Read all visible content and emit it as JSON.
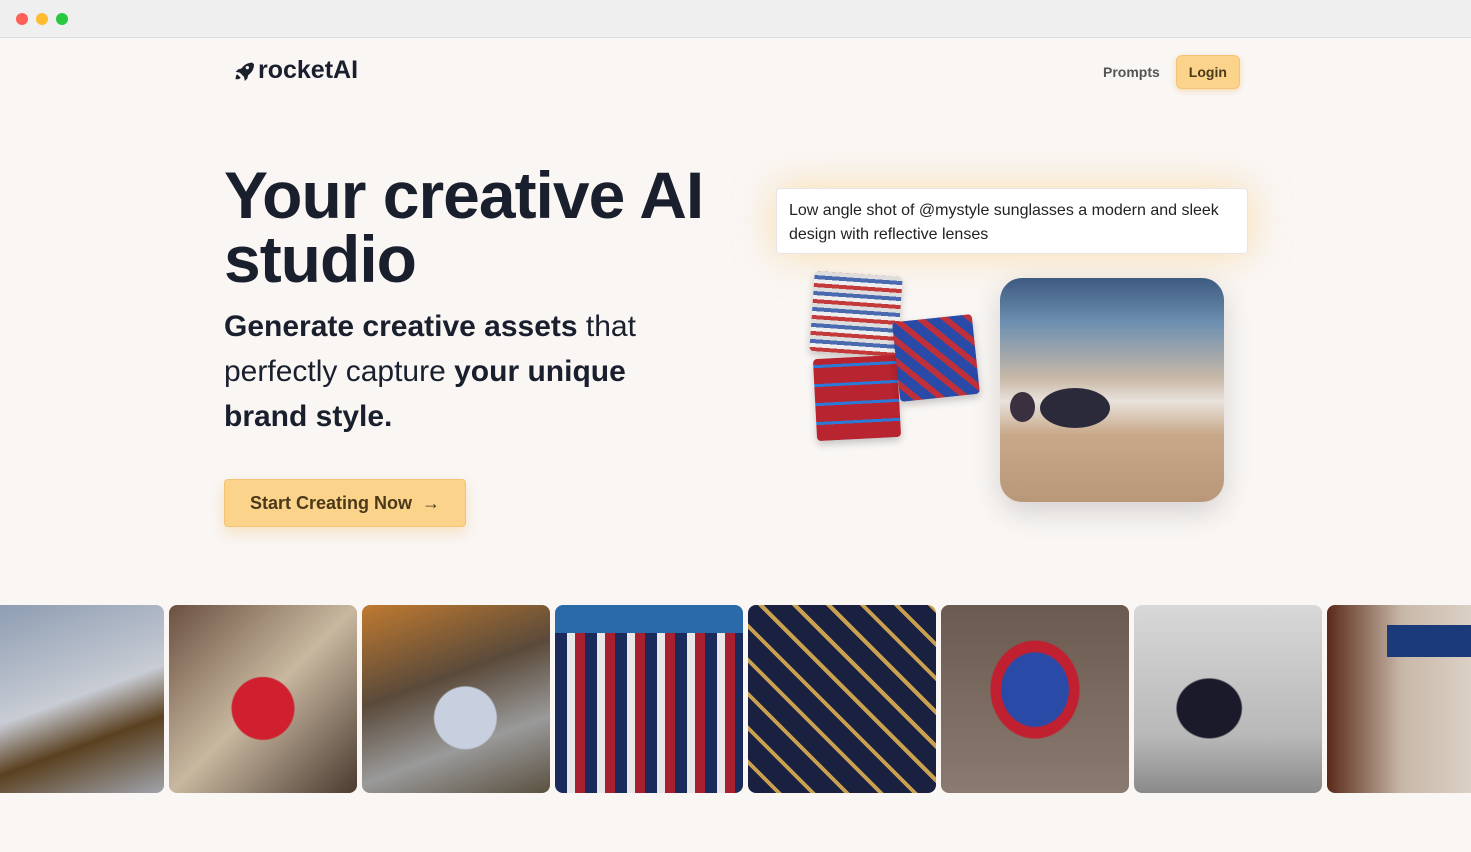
{
  "nav": {
    "logo": "rocketAI",
    "prompts": "Prompts",
    "login": "Login"
  },
  "hero": {
    "title": "Your creative AI studio",
    "subtitle_bold1": "Generate creative assets",
    "subtitle_t1": " that perfectly capture ",
    "subtitle_bold2": "your unique brand style.",
    "cta": "Start Creating Now",
    "cta_icon": "arrow-right-icon"
  },
  "prompt": {
    "text": "Low angle shot of @mystyle sunglasses a modern and sleek design with reflective lenses"
  },
  "colors": {
    "accent": "#fcd38a",
    "text": "#1a1f2e",
    "background": "#f9f6f4"
  },
  "gallery": [
    "sunglasses",
    "red car on road",
    "silver car on road",
    "striped handbag",
    "patterned handbag",
    "blue red armchair",
    "black white chair",
    "lamp"
  ]
}
